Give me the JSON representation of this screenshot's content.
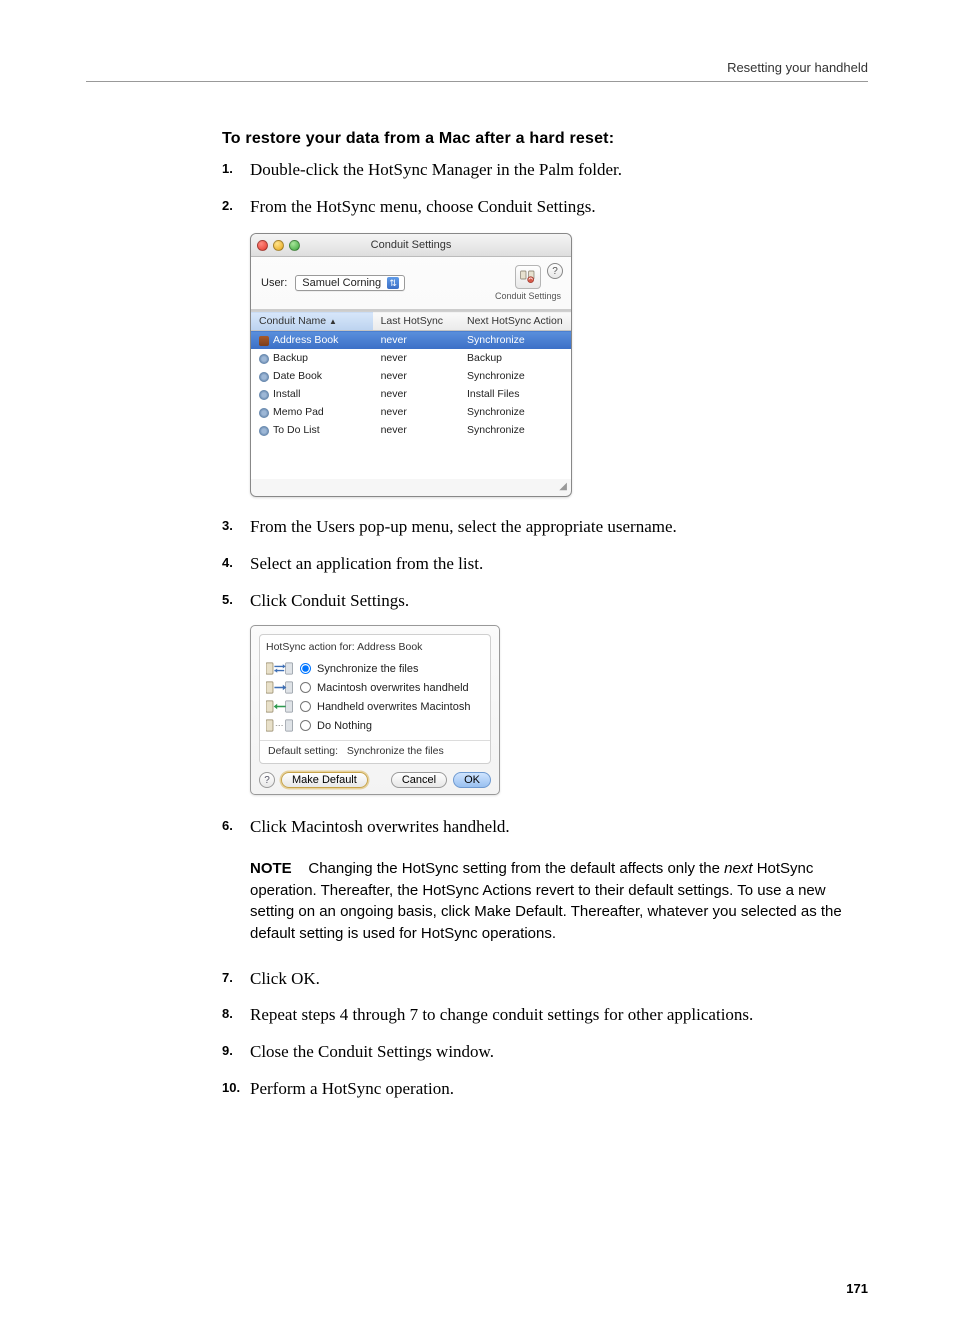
{
  "header": {
    "right": "Resetting your handheld"
  },
  "section_title": "To restore your data from a Mac after a hard reset:",
  "steps": {
    "s1": "Double-click the HotSync Manager in the Palm folder.",
    "s2": "From the HotSync menu, choose Conduit Settings.",
    "s3": "From the Users pop-up menu, select the appropriate username.",
    "s4": "Select an application from the list.",
    "s5": "Click Conduit Settings.",
    "s6": "Click Macintosh overwrites handheld.",
    "s7": "Click OK.",
    "s8": "Repeat steps 4 through 7 to change conduit settings for other applications.",
    "s9": "Close the Conduit Settings window.",
    "s10": "Perform a HotSync operation."
  },
  "note": {
    "label": "NOTE",
    "before_italic": "Changing the HotSync setting from the default affects only the ",
    "italic": "next",
    "after_italic": " HotSync operation. Thereafter, the HotSync Actions revert to their default settings. To use a new setting on an ongoing basis, click Make Default. Thereafter, whatever you selected as the default setting is used for HotSync operations."
  },
  "window1": {
    "title": "Conduit Settings",
    "user_label": "User:",
    "user_value": "Samuel Corning",
    "toolbar_btn_label": "Conduit Settings",
    "help": "?",
    "columns": {
      "c1": "Conduit Name",
      "c2": "Last HotSync",
      "c3": "Next HotSync Action"
    },
    "rows": [
      {
        "name": "Address Book",
        "last": "never",
        "next": "Synchronize",
        "selected": true,
        "icon": "ab"
      },
      {
        "name": "Backup",
        "last": "never",
        "next": "Backup",
        "selected": false,
        "icon": "cog"
      },
      {
        "name": "Date Book",
        "last": "never",
        "next": "Synchronize",
        "selected": false,
        "icon": "cog"
      },
      {
        "name": "Install",
        "last": "never",
        "next": "Install Files",
        "selected": false,
        "icon": "cog"
      },
      {
        "name": "Memo Pad",
        "last": "never",
        "next": "Synchronize",
        "selected": false,
        "icon": "cog"
      },
      {
        "name": "To Do List",
        "last": "never",
        "next": "Synchronize",
        "selected": false,
        "icon": "cog"
      }
    ]
  },
  "dialog": {
    "title_prefix": "HotSync action for:",
    "title_app": "Address Book",
    "options": {
      "o1": "Synchronize the files",
      "o2": "Macintosh overwrites handheld",
      "o3": "Handheld overwrites Macintosh",
      "o4": "Do Nothing"
    },
    "default_label": "Default setting:",
    "default_value": "Synchronize the files",
    "buttons": {
      "make_default": "Make Default",
      "cancel": "Cancel",
      "ok": "OK"
    },
    "help": "?"
  },
  "pagenum": "171"
}
